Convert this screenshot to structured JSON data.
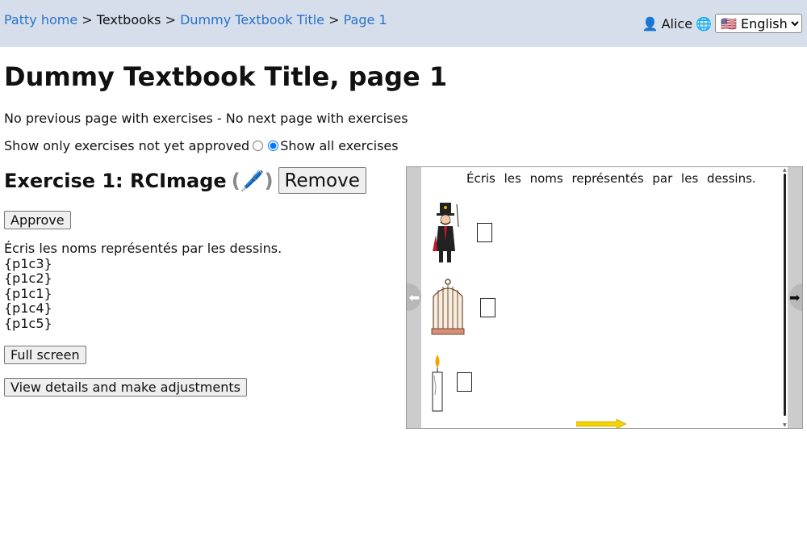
{
  "breadcrumb": {
    "home": "Patty home",
    "sep1": ">",
    "textbooks": "Textbooks",
    "sep2": ">",
    "textbook": "Dummy Textbook Title",
    "sep3": ">",
    "page": "Page 1"
  },
  "user": {
    "icon": "user-icon",
    "name": "Alice",
    "globe_icon": "globe-icon",
    "language": "🇺🇸 English"
  },
  "page_title": "Dummy Textbook Title, page 1",
  "nav_info": "No previous page with exercises - No next page with exercises",
  "filter": {
    "option1": "Show only exercises not yet approved",
    "option2": "Show all exercises",
    "selected": "option2"
  },
  "exercise": {
    "title": "Exercise 1: RCImage",
    "edit_open": "(",
    "edit_icon": "🖊️",
    "edit_close": ")",
    "remove_label": "Remove",
    "approve_label": "Approve",
    "instruction": "Écris les noms représentés par les dessins.",
    "lines": [
      "{p1c3}",
      "{p1c2}",
      "{p1c1}",
      "{p1c4}",
      "{p1c5}"
    ],
    "fullscreen_label": "Full screen",
    "details_label": "View details and make adjustments"
  },
  "viewer": {
    "instruction": "Écris les noms représentés par les dessins.",
    "prev_icon": "arrow-left-icon",
    "next_icon": "arrow-right-icon",
    "prev_glyph": "⬅",
    "next_glyph": "➡"
  },
  "colors": {
    "topbar": "#d5deea",
    "link": "#2a73c9"
  }
}
